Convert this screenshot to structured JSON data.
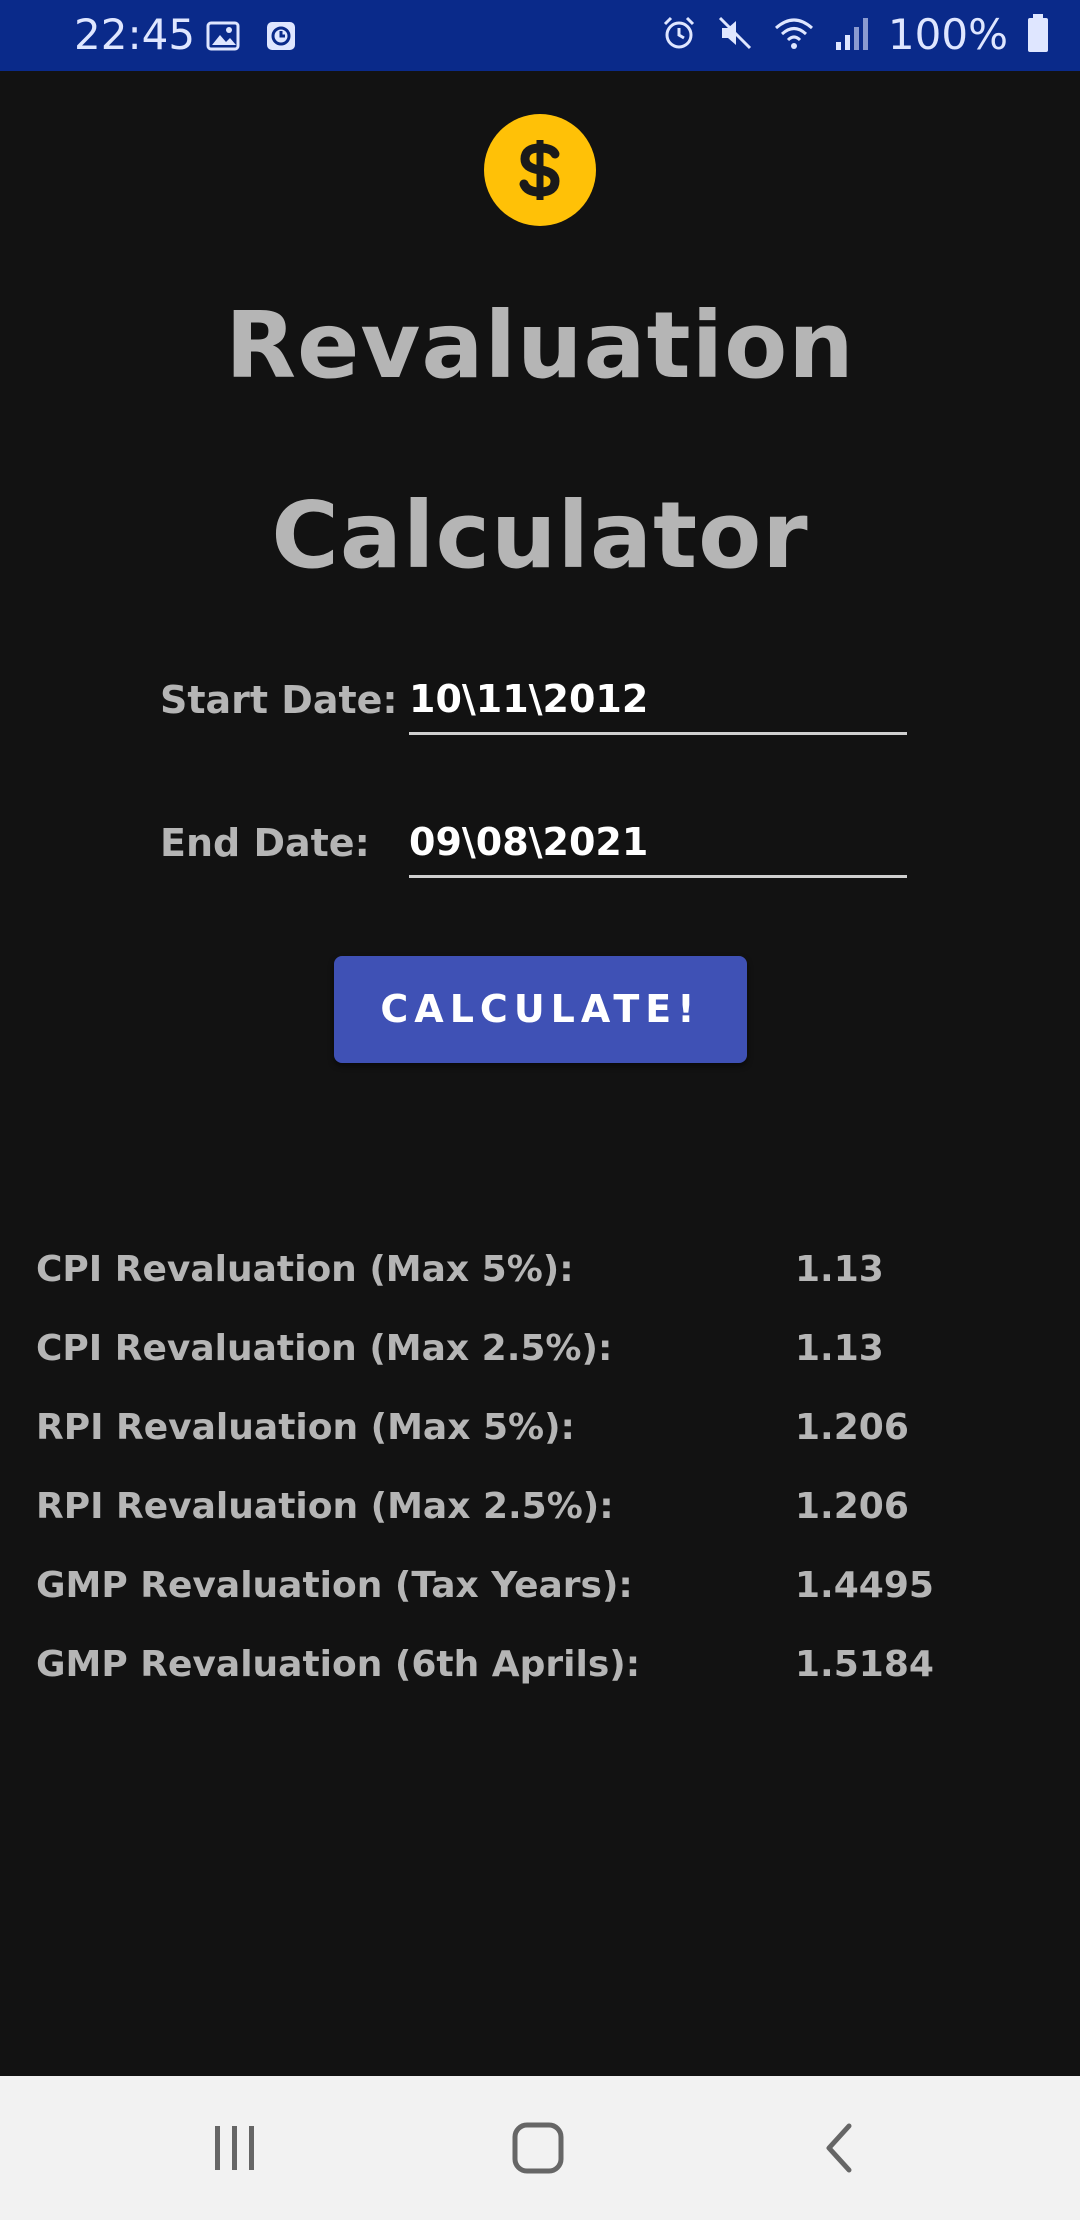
{
  "status_bar": {
    "time": "22:45",
    "battery": "100%",
    "left_icons": [
      "image-icon",
      "clock-app-icon"
    ],
    "right_icons": [
      "alarm-icon",
      "mute-icon",
      "wifi-icon",
      "signal-icon",
      "battery-icon"
    ]
  },
  "app": {
    "logo_icon": "dollar-icon",
    "title_line1": "Revaluation",
    "title_line2": "Calculator",
    "start_date_label": "Start Date:",
    "start_date_value": "10\\11\\2012",
    "end_date_label": "End Date:",
    "end_date_value": "09\\08\\2021",
    "calculate_label": "CALCULATE!"
  },
  "results": [
    {
      "label": "CPI Revaluation (Max 5%):",
      "value": "1.13"
    },
    {
      "label": "CPI Revaluation (Max 2.5%):",
      "value": "1.13"
    },
    {
      "label": "RPI Revaluation (Max 5%):",
      "value": "1.206"
    },
    {
      "label": "RPI Revaluation (Max 2.5%):",
      "value": "1.206"
    },
    {
      "label": "GMP Revaluation (Tax Years):",
      "value": "1.4495"
    },
    {
      "label": "GMP Revaluation (6th Aprils):",
      "value": "1.5184"
    }
  ],
  "nav_bar": {
    "items": [
      "recent-apps-icon",
      "home-icon",
      "back-icon"
    ]
  },
  "colors": {
    "status_bar_bg": "#0a2a8a",
    "background": "#121212",
    "accent_button": "#3f51b5",
    "logo": "#ffc107",
    "text_gray": "#b5b5b5"
  }
}
